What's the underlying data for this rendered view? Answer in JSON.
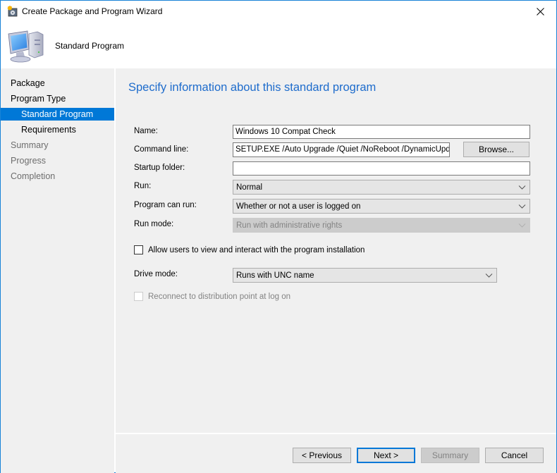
{
  "window": {
    "title": "Create Package and Program Wizard",
    "title_icon": "wizard-icon",
    "close_icon": "close-icon"
  },
  "header": {
    "title": "Standard Program",
    "icon": "computer-icon"
  },
  "sidebar": {
    "items": [
      {
        "label": "Package",
        "state": "normal",
        "level": 0
      },
      {
        "label": "Program Type",
        "state": "normal",
        "level": 0
      },
      {
        "label": "Standard Program",
        "state": "active",
        "level": 1
      },
      {
        "label": "Requirements",
        "state": "normal",
        "level": 1
      },
      {
        "label": "Summary",
        "state": "disabled",
        "level": 0
      },
      {
        "label": "Progress",
        "state": "disabled",
        "level": 0
      },
      {
        "label": "Completion",
        "state": "disabled",
        "level": 0
      }
    ]
  },
  "main": {
    "heading": "Specify information about this standard program",
    "name": {
      "label": "Name:",
      "value": "Windows 10 Compat Check"
    },
    "command_line": {
      "label": "Command line:",
      "value": "SETUP.EXE /Auto Upgrade /Quiet /NoReboot /DynamicUpdat",
      "browse_label": "Browse..."
    },
    "startup_folder": {
      "label": "Startup folder:",
      "value": ""
    },
    "run": {
      "label": "Run:",
      "value": "Normal"
    },
    "program_can_run": {
      "label": "Program can run:",
      "value": "Whether or not a user is logged on"
    },
    "run_mode": {
      "label": "Run mode:",
      "value": "Run with administrative rights",
      "disabled": true
    },
    "allow_interact": {
      "label": "Allow users to view and interact with the program installation",
      "checked": false
    },
    "drive_mode": {
      "label": "Drive mode:",
      "value": "Runs with UNC name"
    },
    "reconnect": {
      "label": "Reconnect to distribution point at log on",
      "checked": false,
      "disabled": true
    }
  },
  "footer": {
    "previous_label": "< Previous",
    "next_label": "Next >",
    "summary_label": "Summary",
    "cancel_label": "Cancel"
  },
  "colors": {
    "accent": "#0078d7",
    "heading": "#1e6ccc",
    "panel_bg": "#f0f0f0"
  }
}
